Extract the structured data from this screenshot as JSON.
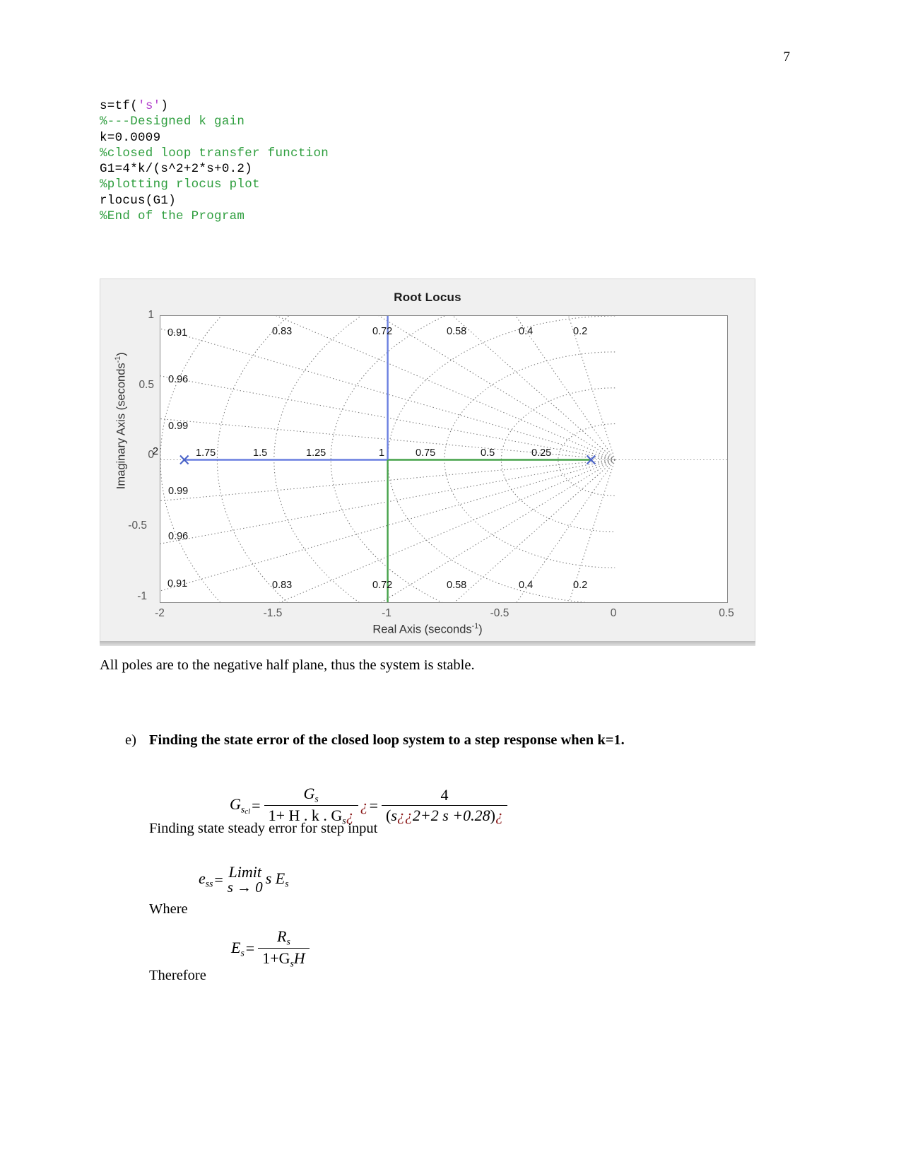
{
  "page": {
    "number": "7"
  },
  "code": {
    "lines": [
      {
        "segments": [
          {
            "text": "s=tf(",
            "style": "plain"
          },
          {
            "text": "'s'",
            "style": "string"
          },
          {
            "text": ")",
            "style": "plain"
          }
        ]
      },
      {
        "segments": [
          {
            "text": "%---Designed k gain",
            "style": "comment"
          }
        ]
      },
      {
        "segments": [
          {
            "text": "k=0.0009",
            "style": "plain"
          }
        ]
      },
      {
        "segments": [
          {
            "text": "%closed loop transfer function",
            "style": "comment"
          }
        ]
      },
      {
        "segments": [
          {
            "text": "G1=4*k/(s^2+2*s+0.2)",
            "style": "plain"
          }
        ]
      },
      {
        "segments": [
          {
            "text": "%plotting rlocus plot",
            "style": "comment"
          }
        ]
      },
      {
        "segments": [
          {
            "text": "rlocus(G1)",
            "style": "plain"
          }
        ]
      },
      {
        "segments": [
          {
            "text": "%End of the Program",
            "style": "comment"
          }
        ]
      }
    ]
  },
  "figure": {
    "title": "Root Locus",
    "xlabel_text": "Real Axis (seconds",
    "xlabel_exp": "-1",
    "xlabel_close": ")",
    "ylabel_text": "Imaginary Axis (seconds",
    "ylabel_exp": "-1",
    "ylabel_close": ")"
  },
  "chart_data": {
    "type": "scatter",
    "title": "Root Locus",
    "xlabel": "Real Axis (seconds^-1)",
    "ylabel": "Imaginary Axis (seconds^-1)",
    "xlim": [
      -2,
      0.5
    ],
    "ylim": [
      -1,
      1
    ],
    "xticks": [
      "-2",
      "-1.5",
      "-1",
      "-0.5",
      "0",
      "0.5"
    ],
    "xtick_values": [
      -2,
      -1.5,
      -1,
      -0.5,
      0,
      0.5
    ],
    "yticks": [
      "1",
      "0.5",
      "0",
      "-0.5",
      "-1"
    ],
    "ytick_values": [
      1,
      0.5,
      0,
      -0.5,
      -1
    ],
    "grid": "s-plane damping/natural-frequency grid (dotted)",
    "damping_ratio_labels_upper": [
      "0.91",
      "0.96",
      "0.99",
      "0.83",
      "0.72",
      "0.58",
      "0.4",
      "0.2"
    ],
    "damping_ratio_labels_lower": [
      "0.99",
      "0.96",
      "0.91",
      "0.83",
      "0.72",
      "0.58",
      "0.4",
      "0.2"
    ],
    "natural_frequency_labels": [
      "2",
      "1.75",
      "1.5",
      "1.25",
      "1",
      "0.75",
      "0.5",
      "0.25"
    ],
    "poles": [
      {
        "label": "pole-1",
        "x": -1.895,
        "y": 0,
        "marker": "x",
        "color": "#5b6fd6"
      },
      {
        "label": "pole-2",
        "x": -0.105,
        "y": 0,
        "marker": "x",
        "color": "#5b6fd6"
      }
    ],
    "locus_branches": [
      {
        "name": "branch-blue",
        "color": "#6a7fe0",
        "from_x": -1.895,
        "to_x": -1.0,
        "y": 0
      },
      {
        "name": "branch-green",
        "color": "#46a24a",
        "from_x": -1.0,
        "to_x": -0.105,
        "y": 0
      },
      {
        "name": "branch-blue-vertical",
        "color": "#6a7fe0",
        "x": -1.0,
        "from_y": 0,
        "to_y": 1
      },
      {
        "name": "branch-green-vertical",
        "color": "#46a24a",
        "x": -1.0,
        "from_y": -1,
        "to_y": 0
      }
    ],
    "legend": null
  },
  "body": {
    "stability_note": "All poles are to the negative half plane, thus the system is stable.",
    "heading_e_marker": "e)",
    "heading_e_text": "Finding the state error of the closed loop system to a step response when k=1.",
    "finding_steady": "Finding state steady error for step input",
    "where": "Where",
    "therefore": "Therefore"
  },
  "equations": {
    "eq1": {
      "lhs_base": "G",
      "lhs_sub": "s",
      "lhs_subsub": "cl",
      "eq": "=",
      "frac1_num": "G",
      "frac1_num_sub": "s",
      "frac1_den": "1+ H . k . G",
      "frac1_den_sub": "s",
      "frac1_den_qm": "¿",
      "mid_qm": "¿",
      "eq2": "=",
      "frac2_num": "4",
      "frac2_den_open": "(",
      "frac2_den_s": "s",
      "frac2_den_qm1": "¿",
      "frac2_den_qm2": "¿",
      "frac2_den_rest": "2+2 s +0.28",
      "frac2_den_close": ")",
      "frac2_den_qm3": "¿"
    },
    "eq2": {
      "lhs": "e",
      "lhs_sub": "ss",
      "eq": "=",
      "limit_top": "Limit",
      "limit_bot": "s → 0",
      "rhs": "s E",
      "rhs_sub": "s"
    },
    "eq3": {
      "lhs": "E",
      "lhs_sub": "s",
      "eq": "=",
      "num": "R",
      "num_sub": "s",
      "den": "1+G",
      "den_sub": "s",
      "den_tail": "H"
    }
  }
}
